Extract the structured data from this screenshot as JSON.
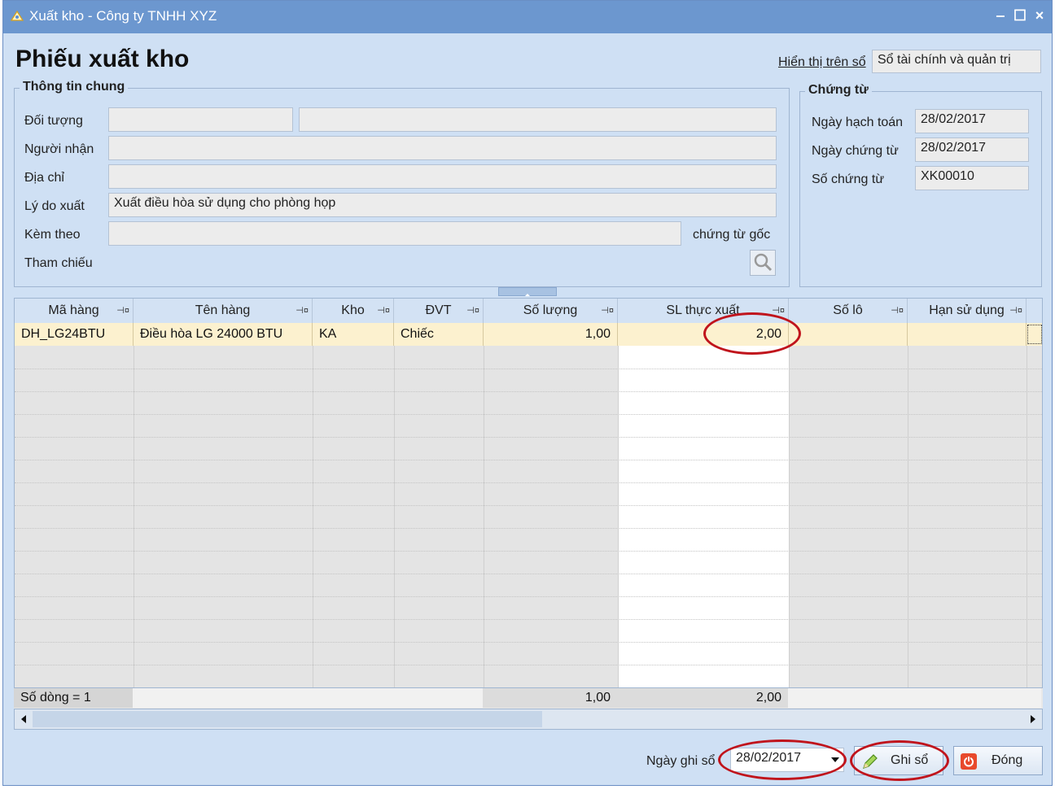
{
  "window": {
    "title": "Xuất kho - Công ty TNHH XYZ",
    "minimize": "‒",
    "maximize": "☐",
    "close": "×"
  },
  "form": {
    "title": "Phiếu xuất kho",
    "display_on_book_label": "Hiển thị trên sổ",
    "display_on_book_value": "Sổ tài chính và quản trị"
  },
  "general": {
    "group_title": "Thông tin chung",
    "doi_tuong_label": "Đối tượng",
    "doi_tuong_code": "",
    "doi_tuong_name": "",
    "nguoi_nhan_label": "Người nhận",
    "nguoi_nhan_value": "",
    "dia_chi_label": "Địa chỉ",
    "dia_chi_value": "",
    "ly_do_label": "Lý do xuất",
    "ly_do_value": "Xuất điều hòa sử dụng cho phòng họp",
    "kem_theo_label": "Kèm theo",
    "kem_theo_value": "",
    "chung_tu_goc_label": "chứng từ gốc",
    "tham_chieu_label": "Tham chiếu"
  },
  "voucher": {
    "group_title": "Chứng từ",
    "ngay_hach_toan_label": "Ngày hạch toán",
    "ngay_hach_toan_value": "28/02/2017",
    "ngay_chung_tu_label": "Ngày chứng từ",
    "ngay_chung_tu_value": "28/02/2017",
    "so_chung_tu_label": "Số chứng từ",
    "so_chung_tu_value": "XK00010"
  },
  "grid": {
    "columns": [
      "Mã hàng",
      "Tên hàng",
      "Kho",
      "ĐVT",
      "Số lượng",
      "SL thực xuất",
      "Số lô",
      "Hạn sử dụng"
    ],
    "rows": [
      [
        "DH_LG24BTU",
        "Điều hòa LG 24000 BTU",
        "KA",
        "Chiếc",
        "1,00",
        "2,00",
        "",
        ""
      ]
    ],
    "footer": {
      "row_count": "Số dòng = 1",
      "total_so_luong": "1,00",
      "total_sl_thuc_xuat": "2,00"
    }
  },
  "bottom": {
    "ngay_ghi_so_label": "Ngày ghi sổ",
    "ngay_ghi_so_value": "28/02/2017",
    "ghi_so_button": "Ghi sổ",
    "dong_button": "Đóng"
  },
  "colors": {
    "titlebar": "#6c97cf",
    "window_bg": "#cfe0f4",
    "selected_row": "#fcf1cf",
    "highlight_oval": "#c0141c"
  }
}
